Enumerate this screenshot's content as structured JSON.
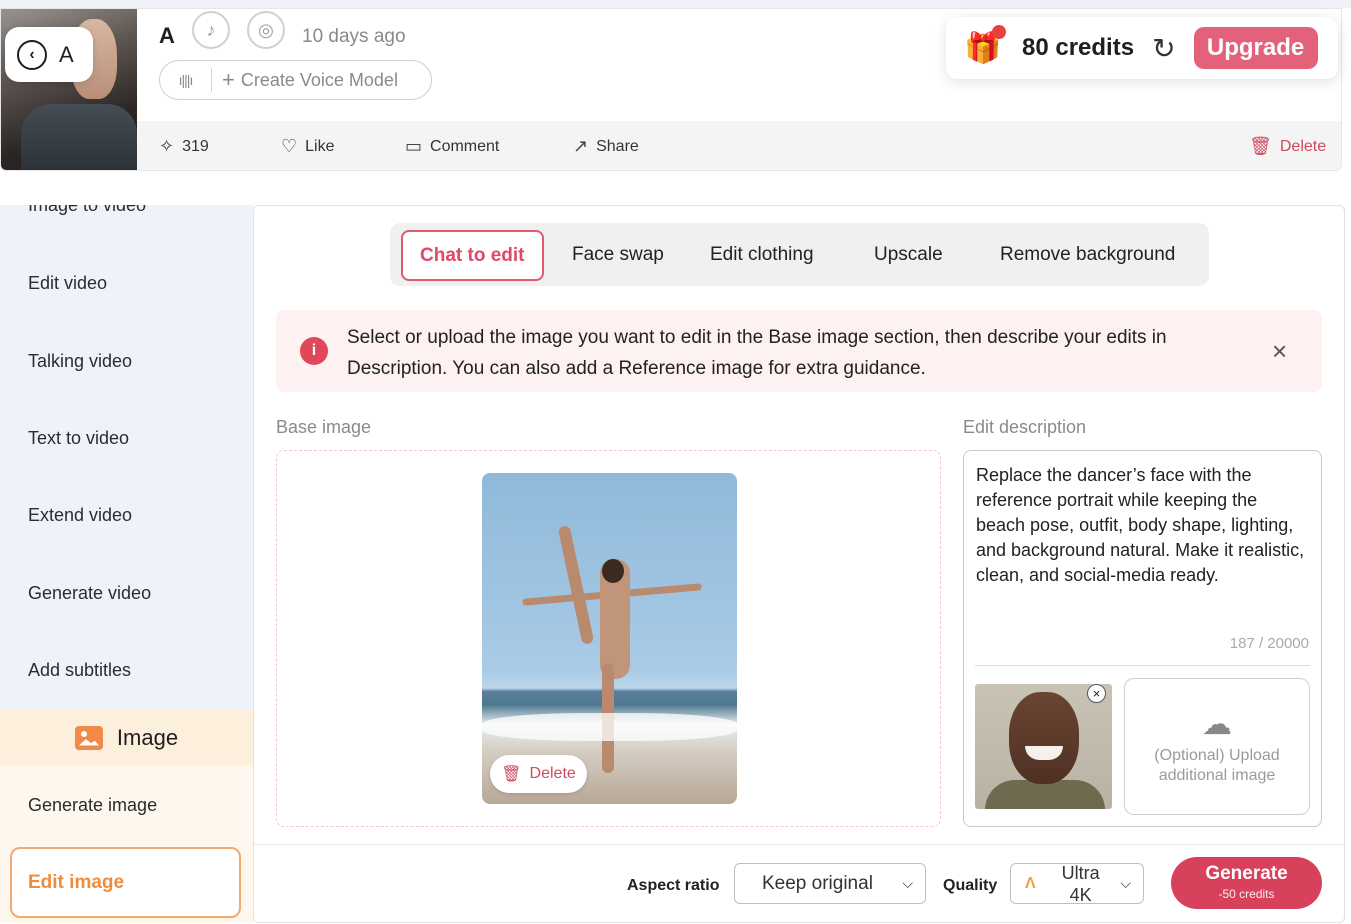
{
  "header": {
    "back_letter": "A",
    "owner_name": "A",
    "time_ago": "10 days ago",
    "voice_button": "Create Voice Model",
    "actions": {
      "count": "319",
      "like": "Like",
      "comment": "Comment",
      "share": "Share",
      "delete": "Delete"
    },
    "credits": "80 credits",
    "upgrade": "Upgrade"
  },
  "sidebar": {
    "items": [
      "Image to video",
      "Edit video",
      "Talking video",
      "Text to video",
      "Extend video",
      "Generate video",
      "Add subtitles"
    ],
    "image_section": "Image",
    "image_items": [
      "Generate image",
      "Edit image"
    ]
  },
  "tabs": [
    "Chat to edit",
    "Face swap",
    "Edit clothing",
    "Upscale",
    "Remove background"
  ],
  "notice": {
    "text": "Select or upload the image you want to edit in the Base image section, then describe your edits in Description. You can also add a Reference image for extra guidance."
  },
  "base_image": {
    "label": "Base image",
    "delete": "Delete"
  },
  "edit_description": {
    "label": "Edit description",
    "text": "Replace the dancer’s face with the reference portrait while keeping the beach pose, outfit, body shape, lighting, and background natural. Make it realistic, clean, and social-media ready.",
    "counter": "187 / 20000",
    "upload_text": "(Optional) Upload additional image"
  },
  "bottom": {
    "aspect_label": "Aspect ratio",
    "aspect_value": "Keep original",
    "quality_label": "Quality",
    "quality_value": "Ultra 4K",
    "generate": "Generate",
    "generate_cost": "-50 credits"
  },
  "colors": {
    "accent": "#e0476a",
    "upgrade": "#e3617a",
    "generate": "#d8415c",
    "sidebar_bg": "#eef2fa",
    "edit_image_accent": "#ef8d3f"
  }
}
